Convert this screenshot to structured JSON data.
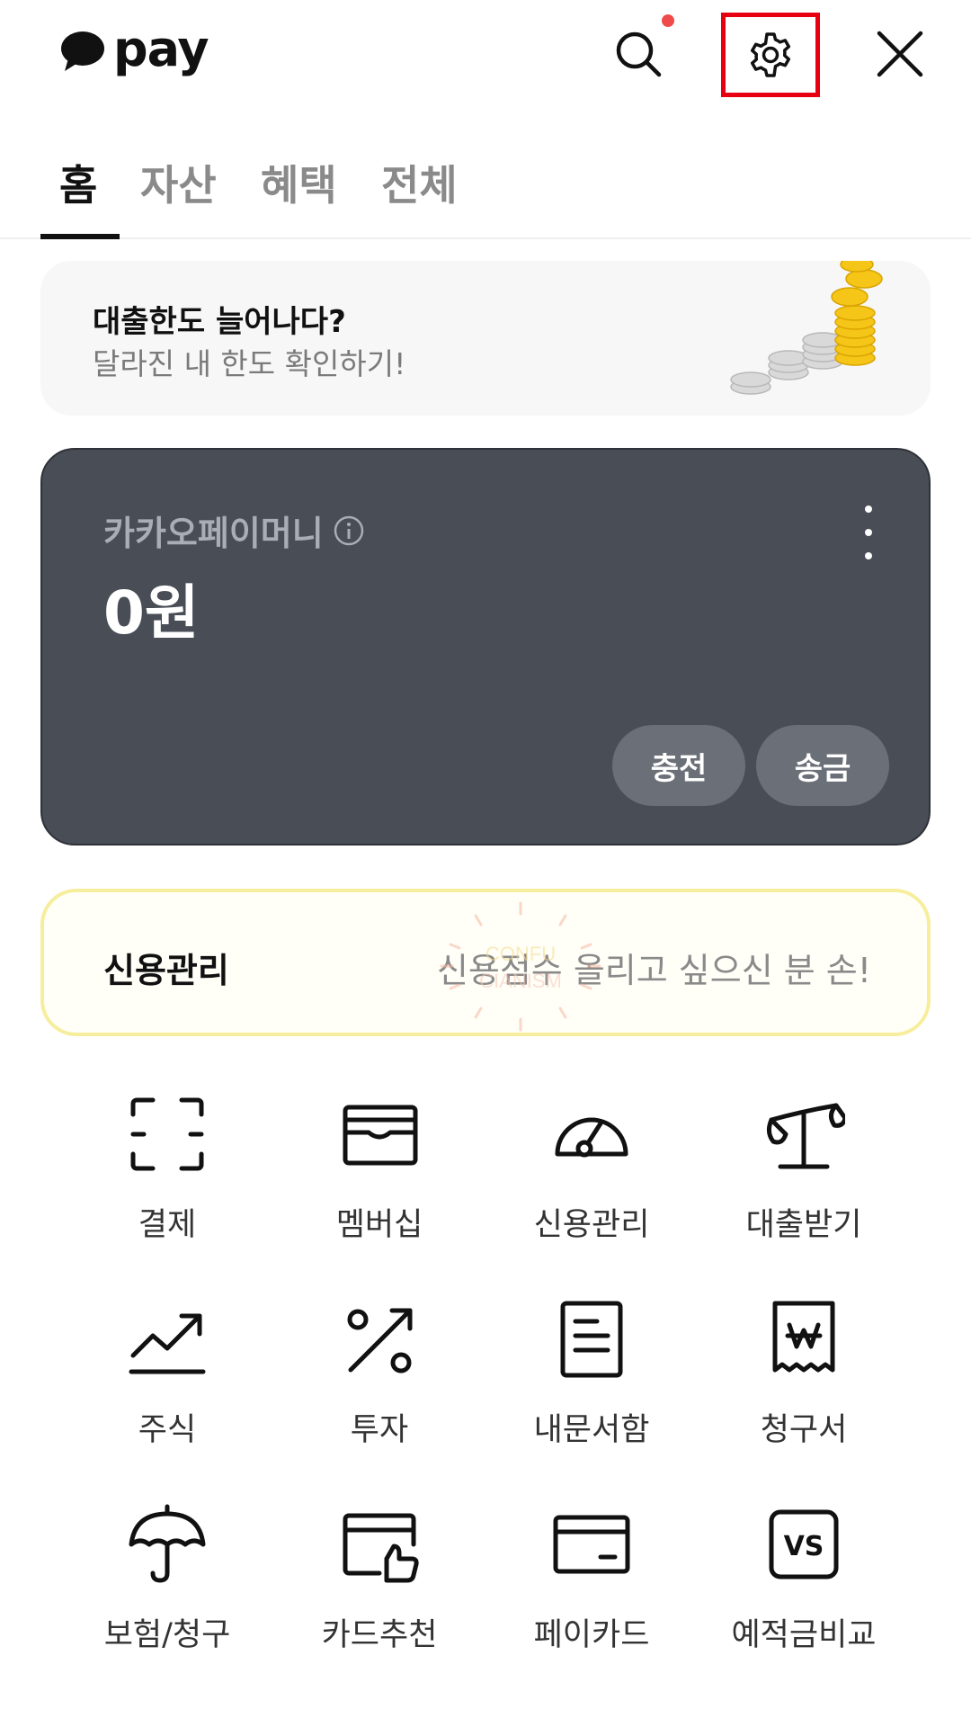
{
  "header": {
    "logo_text": "pay",
    "search_icon": "search-icon",
    "settings_icon": "gear-icon",
    "close_icon": "close-icon",
    "notification_dot_color": "#f04b4b",
    "highlight_color": "#e60012"
  },
  "tabs": [
    {
      "label": "홈",
      "active": true
    },
    {
      "label": "자산",
      "active": false
    },
    {
      "label": "혜택",
      "active": false
    },
    {
      "label": "전체",
      "active": false
    }
  ],
  "banner": {
    "title": "대출한도 늘어나다?",
    "subtitle": "달라진 내 한도 확인하기!",
    "image": "coin-stack-illustration"
  },
  "money_card": {
    "label": "카카오페이머니",
    "amount": "0원",
    "info_icon": "info-icon",
    "more_icon": "more-vertical-icon",
    "charge_label": "충전",
    "send_label": "송금",
    "background_color": "#484d56"
  },
  "credit_banner": {
    "title": "신용관리",
    "subtitle": "신용점수 올리고 싶으신 분 손!",
    "border_color": "#f6ee9c"
  },
  "menu": [
    {
      "label": "결제",
      "icon": "scan-icon"
    },
    {
      "label": "멤버십",
      "icon": "wallet-icon"
    },
    {
      "label": "신용관리",
      "icon": "gauge-icon"
    },
    {
      "label": "대출받기",
      "icon": "scale-icon"
    },
    {
      "label": "주식",
      "icon": "chart-up-icon"
    },
    {
      "label": "투자",
      "icon": "percent-icon"
    },
    {
      "label": "내문서함",
      "icon": "document-icon"
    },
    {
      "label": "청구서",
      "icon": "bill-icon"
    },
    {
      "label": "보험/청구",
      "icon": "umbrella-icon"
    },
    {
      "label": "카드추천",
      "icon": "card-thumbs-up-icon"
    },
    {
      "label": "페이카드",
      "icon": "credit-card-icon"
    },
    {
      "label": "예적금비교",
      "icon": "vs-icon"
    }
  ]
}
